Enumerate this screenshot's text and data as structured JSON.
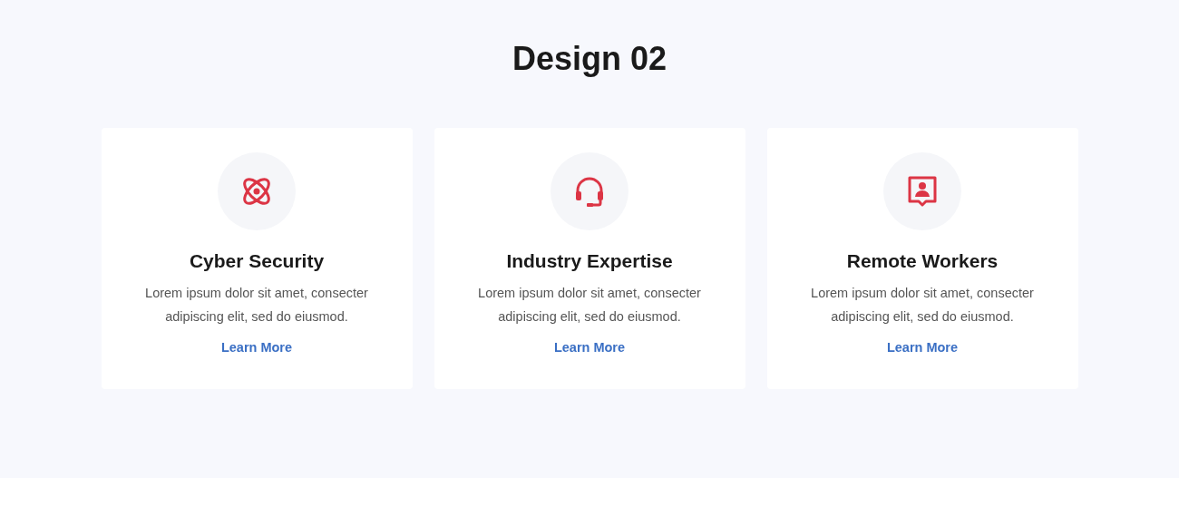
{
  "title": "Design 02",
  "cards": [
    {
      "heading": "Cyber Security",
      "text": "Lorem ipsum dolor sit amet, consecter adipiscing elit, sed do eiusmod.",
      "link": "Learn More"
    },
    {
      "heading": "Industry Expertise",
      "text": "Lorem ipsum dolor sit amet, consecter adipiscing elit, sed do eiusmod.",
      "link": "Learn More"
    },
    {
      "heading": "Remote Workers",
      "text": "Lorem ipsum dolor sit amet, consecter adipiscing elit, sed do eiusmod.",
      "link": "Learn More"
    }
  ]
}
